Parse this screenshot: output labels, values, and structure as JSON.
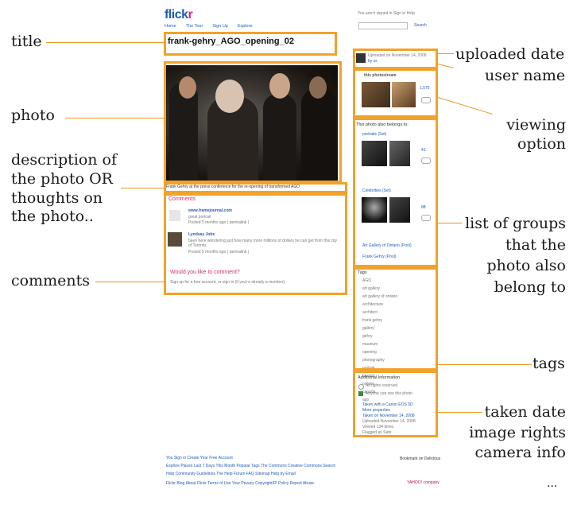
{
  "annotations": {
    "title": "title",
    "photo": "photo",
    "description": [
      "description of",
      "the photo OR",
      "thoughts on",
      "the photo.."
    ],
    "comments": "comments",
    "uploaded_date": "uploaded date",
    "user_name": "user name",
    "viewing_option": [
      "viewing",
      "option"
    ],
    "groups": [
      "list of groups",
      "that the",
      "photo also",
      "belong to"
    ],
    "tags": "tags",
    "info": [
      "taken date",
      "image rights",
      "camera info"
    ],
    "ellipsis": "..."
  },
  "flickr": {
    "logo_main": "flick",
    "logo_accent": "r",
    "nav": [
      "Home",
      "The Tour",
      "Sign Up",
      "Explore"
    ],
    "search_label": "Search",
    "top_right": "You aren't signed in   Sign in   Help",
    "photo_title": "frank-gehry_AGO_opening_02",
    "description": "Frank Gehry at the press conference for the re-opening of transformed AGO",
    "comments_heading": "Comments",
    "comments": [
      {
        "user": "www.framejournal.com",
        "text": "great portrait",
        "meta": "Posted 5 months ago ( permalink )"
      },
      {
        "user": "Lyndsay Jobs",
        "text": "been here wondering just how many more millions of dollars he can get from this city of Toronto.",
        "meta": "Posted 5 months ago ( permalink )"
      }
    ],
    "comment_prompt": "Would you like to comment?",
    "comment_signup": "Sign up for a free account, or sign in (if you're already a member).",
    "uploaded": "Uploaded on November 14, 2008",
    "uploaded_by": "by ss",
    "photostream": "this photostream",
    "photostream_count": "1,575",
    "groups_heading": "This photo also belongs to:",
    "groups": [
      "portraits (Set)",
      "Celebrities (Set)"
    ],
    "group_counts": [
      "41",
      "88"
    ],
    "group_extra": [
      "Art Gallery of Ontario (Pool)",
      "Frank Gehry (Pool)"
    ],
    "tags_heading": "Tags",
    "tags": [
      "AGO",
      "art gallery",
      "art gallery of ontario",
      "architecture",
      "architect",
      "frank gehry",
      "gallery",
      "gehry",
      "museum",
      "opening",
      "photography",
      "portrait",
      "toronto",
      "ontario",
      "canada",
      "ago"
    ],
    "info_heading": "Additional Information",
    "info": [
      "All rights reserved",
      "Anyone can see this photo",
      "Taken with a Canon EOS 5D",
      "More properties",
      "Taken on November 14, 2008",
      "Uploaded November 14, 2008",
      "Viewed 134 times",
      "Flagged as Safe"
    ],
    "footer_rows": [
      "You   Sign in   Create Your Free Account",
      "Explore   Places   Last 7 Days   This Month   Popular Tags   The Commons   Creative Commons   Search",
      "Help   Community Guidelines   The Help Forum   FAQ   Sitemap   Help by Email",
      "Flickr Blog   About Flickr   Terms of Use   Your Privacy   Copyright/IP Policy   Report Abuse"
    ],
    "bookmark": "Bookmark on Delicious",
    "yahoo": "YAHOO! company"
  }
}
